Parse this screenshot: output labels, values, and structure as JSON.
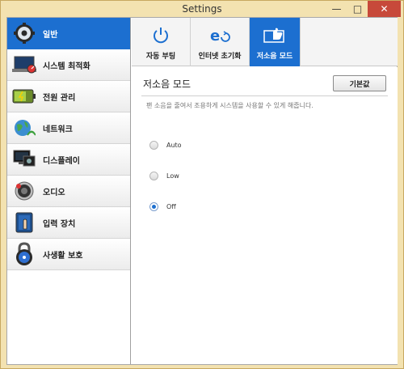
{
  "window": {
    "title": "Settings",
    "min_glyph": "—",
    "max_glyph": "□",
    "close_glyph": "✕"
  },
  "sidebar": {
    "items": [
      {
        "label": "일반",
        "icon": "gear-icon",
        "active": true
      },
      {
        "label": "시스템 최적화",
        "icon": "laptop-gauge-icon",
        "active": false
      },
      {
        "label": "전원 관리",
        "icon": "battery-icon",
        "active": false
      },
      {
        "label": "네트워크",
        "icon": "globe-wifi-icon",
        "active": false
      },
      {
        "label": "디스플레이",
        "icon": "display-icon",
        "active": false
      },
      {
        "label": "오디오",
        "icon": "speaker-icon",
        "active": false
      },
      {
        "label": "입력 장치",
        "icon": "touch-icon",
        "active": false
      },
      {
        "label": "사생활 보호",
        "icon": "padlock-icon",
        "active": false
      }
    ]
  },
  "tabs": [
    {
      "label": "자동 부팅",
      "icon": "power-icon",
      "active": false
    },
    {
      "label": "인터넷 초기화",
      "icon": "internet-reset-icon",
      "active": false
    },
    {
      "label": "저소음 모드",
      "icon": "quiet-mode-icon",
      "active": true
    }
  ],
  "content": {
    "title": "저소음 모드",
    "default_button": "기본값",
    "description": "팬 소음을 줄여서 조용하게 시스템을 사용할 수 있게 해줍니다.",
    "options": [
      {
        "label": "Auto",
        "selected": false
      },
      {
        "label": "Low",
        "selected": false
      },
      {
        "label": "Off",
        "selected": true
      }
    ]
  },
  "colors": {
    "accent": "#1c6fd0",
    "titlebar": "#f3e2b0",
    "close": "#c7493a"
  }
}
